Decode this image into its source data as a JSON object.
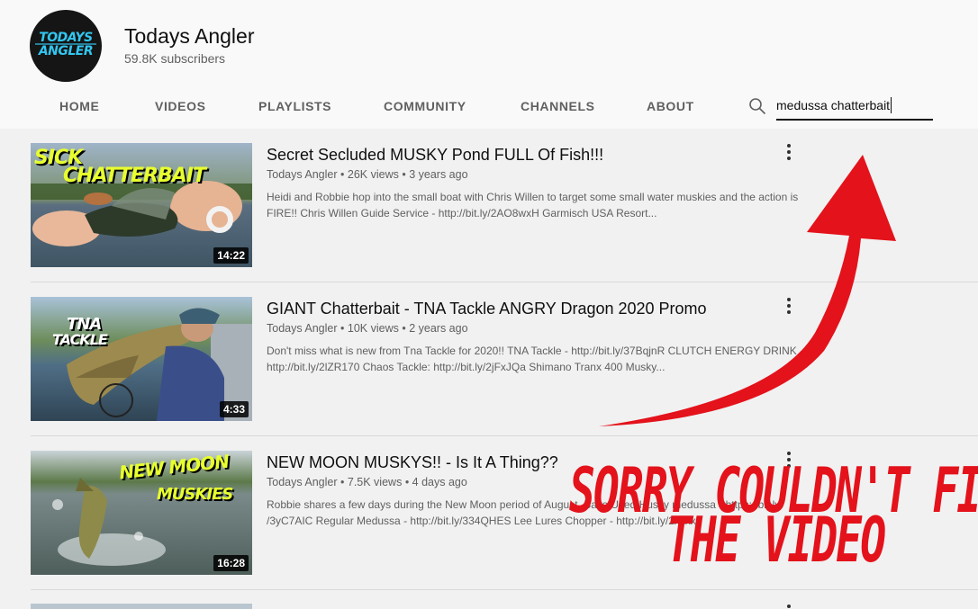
{
  "channel": {
    "avatar_line1": "TODAYS",
    "avatar_line2": "ANGLER",
    "name": "Todays Angler",
    "subscribers": "59.8K subscribers"
  },
  "tabs": [
    "HOME",
    "VIDEOS",
    "PLAYLISTS",
    "COMMUNITY",
    "CHANNELS",
    "ABOUT"
  ],
  "search": {
    "value": "medussa chatterbait",
    "icon": "search-icon"
  },
  "videos": [
    {
      "title": "Secret Secluded MUSKY Pond FULL Of Fish!!!",
      "channel": "Todays Angler",
      "views": "26K views",
      "age": "3 years ago",
      "desc_line1": "Heidi and Robbie hop into the small boat with Chris Willen to target some small water muskies and the action is",
      "desc_line2": "FIRE!! Chris Willen Guide Service - http://bit.ly/2AO8wxH Garmisch USA Resort...",
      "duration": "14:22",
      "thumb_text1": "SICK",
      "thumb_text2": "CHATTERBAIT"
    },
    {
      "title": "GIANT Chatterbait - TNA Tackle ANGRY Dragon 2020 Promo",
      "channel": "Todays Angler",
      "views": "10K views",
      "age": "2 years ago",
      "desc_line1": "Don't miss what is new from Tna Tackle for 2020!! TNA Tackle - http://bit.ly/37BqjnR CLUTCH ENERGY DRINK -",
      "desc_line2": "http://bit.ly/2lZR170 Chaos Tackle: http://bit.ly/2jFxJQa Shimano Tranx 400 Musky...",
      "duration": "4:33",
      "thumb_text1": "TNA",
      "thumb_text2": "TACKLE"
    },
    {
      "title": "NEW MOON MUSKYS!! - Is It A Thing??",
      "channel": "Todays Angler",
      "views": "7.5K views",
      "age": "4 days ago",
      "desc_line1": "Robbie shares a few days during the New Moon period of August. Baits Used Husky medussa - https://bit.ly",
      "desc_line2": "/3yC7AIC Regular Medussa - http://bit.ly/334QHES Lee Lures Chopper - http://bit.ly/2xxxxx",
      "duration": "16:28",
      "thumb_text1": "NEW MOON",
      "thumb_text2": "MUSKIES"
    }
  ],
  "annotation": {
    "line1": "SORRY COULDN'T FIND",
    "line2": "THE VIDEO",
    "color": "#e4121b"
  },
  "colors": {
    "header_bg": "#f9f9f9",
    "page_bg": "#f1f1f1",
    "meta_text": "#606060",
    "accent_red": "#e4121b"
  }
}
